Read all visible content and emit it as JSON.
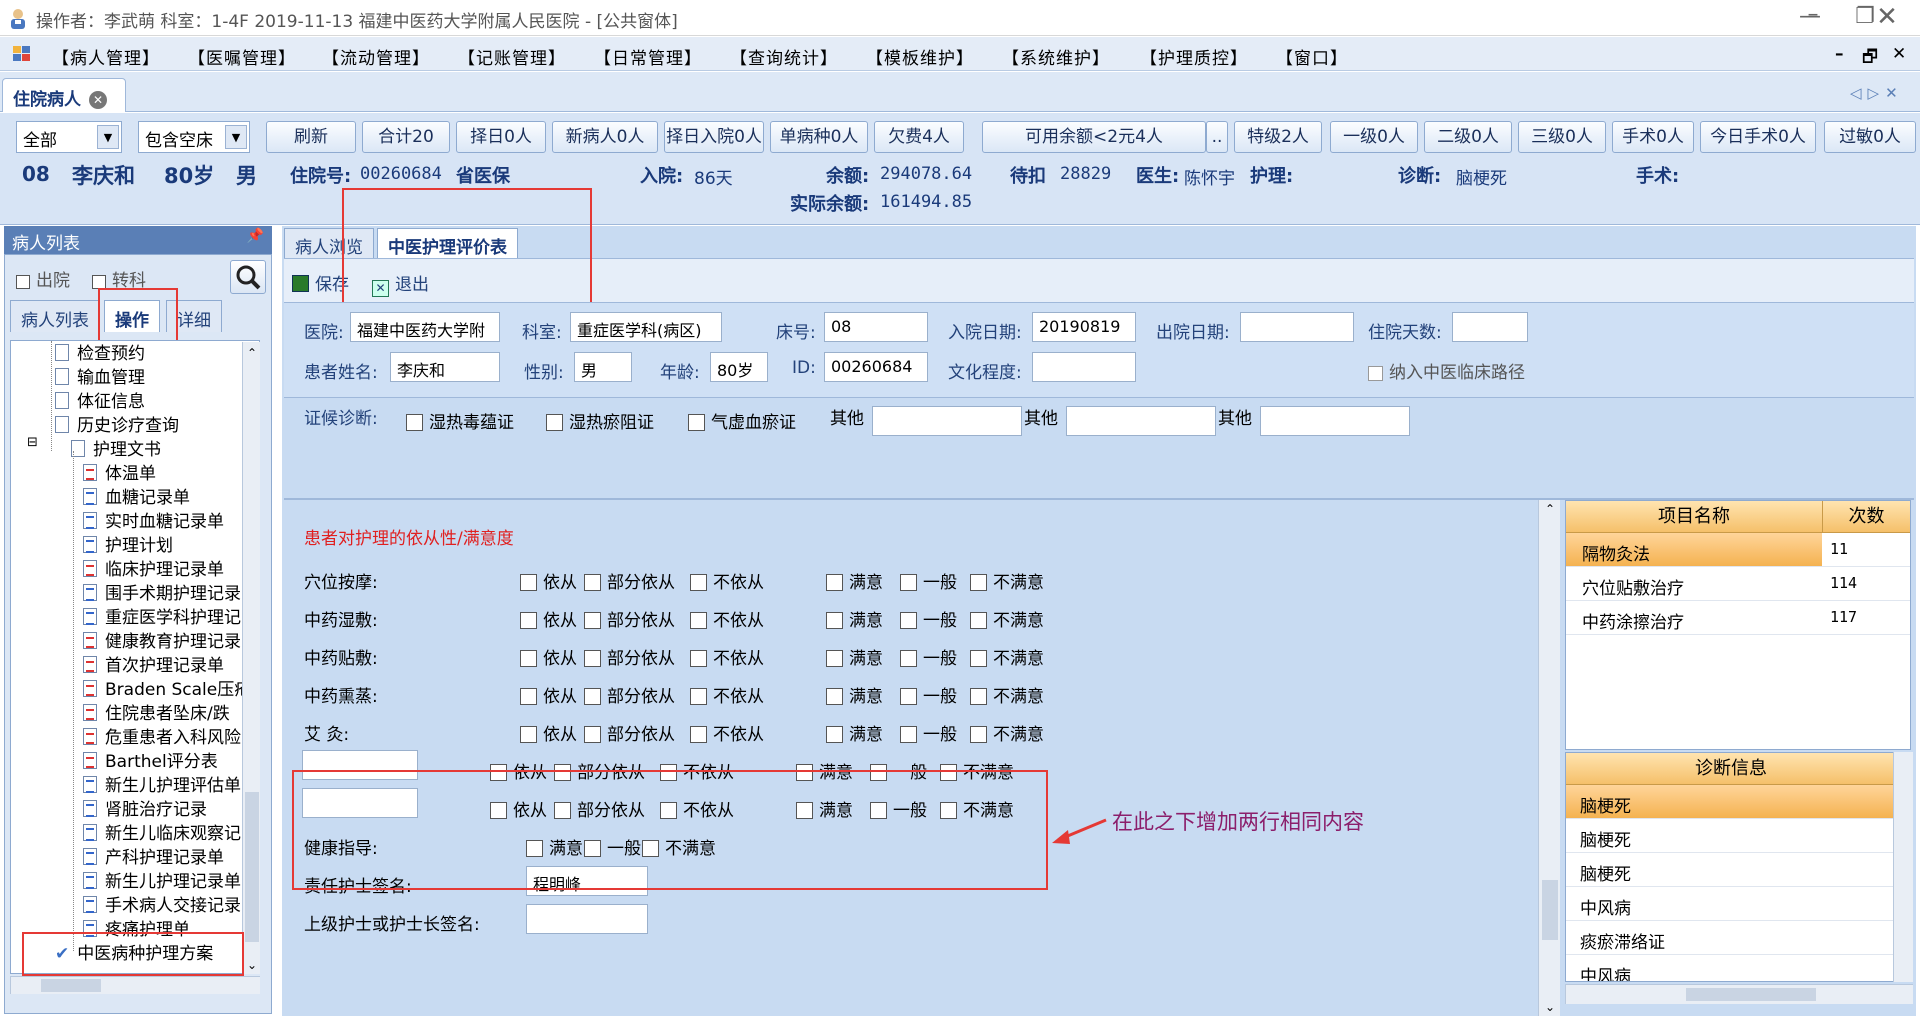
{
  "window": {
    "title": "操作者：李武萌  科室：1-4F  2019-11-13  福建中医药大学附属人民医院 - [公共窗体]"
  },
  "menu": [
    "【病人管理】",
    "【医嘱管理】",
    "【流动管理】",
    "【记账管理】",
    "【日常管理】",
    "【查询统计】",
    "【模板维护】",
    "【系统维护】",
    "【护理质控】",
    "【窗口】"
  ],
  "doc_tab": "住院病人",
  "toolbar": {
    "filter_all": "全部",
    "filter_bed": "包含空床",
    "buttons": [
      "刷新",
      "合计20",
      "择日0人",
      "新病人0人",
      "择日入院0人",
      "单病种0人",
      "欠费4人",
      "可用余额<2元4人",
      "..",
      "特级2人",
      "一级0人",
      "二级0人",
      "三级0人",
      "手术0人",
      "今日手术0人",
      "过敏0人"
    ]
  },
  "patient": {
    "bed": "08",
    "name": "李庆和",
    "age": "80岁",
    "sex": "男",
    "admission_label": "住院号:",
    "admission_no": "00260684",
    "insurance": "省医保",
    "in_label": "入院:",
    "in_days": "86天",
    "balance_label": "余额:",
    "balance": "294078.64",
    "pending_label": "待扣",
    "pending": "28829",
    "doctor_label": "医生:",
    "doctor": "陈怀宇",
    "nurse_label": "护理:",
    "nurse": "",
    "diagnosis_label": "诊断:",
    "diagnosis": "脑梗死",
    "surgery_label": "手术:",
    "surgery": "",
    "actual_label": "实际余额:",
    "actual_balance": "161494.85"
  },
  "left": {
    "header": "病人列表",
    "pin": "ㅁ",
    "chk_discharged": "出院",
    "chk_transfer": "转科",
    "tabs": [
      "病人列表",
      "操作",
      "详细"
    ],
    "tree": [
      {
        "label": "检查预约",
        "icon": "doc",
        "indent": 1
      },
      {
        "label": "输血管理",
        "icon": "doc",
        "indent": 1
      },
      {
        "label": "体征信息",
        "icon": "doc",
        "indent": 1
      },
      {
        "label": "历史诊疗查询",
        "icon": "doc",
        "indent": 1
      },
      {
        "label": "护理文书",
        "icon": "doc",
        "indent": 0
      },
      {
        "label": "体温单",
        "icon": "red",
        "indent": 2
      },
      {
        "label": "血糖记录单",
        "icon": "blue",
        "indent": 2
      },
      {
        "label": "实时血糖记录单",
        "icon": "blue",
        "indent": 2
      },
      {
        "label": "护理计划",
        "icon": "blue",
        "indent": 2
      },
      {
        "label": "临床护理记录单",
        "icon": "red",
        "indent": 2
      },
      {
        "label": "围手术期护理记录",
        "icon": "blue",
        "indent": 2
      },
      {
        "label": "重症医学科护理记",
        "icon": "blue",
        "indent": 2
      },
      {
        "label": "健康教育护理记录",
        "icon": "red",
        "indent": 2
      },
      {
        "label": "首次护理记录单",
        "icon": "red",
        "indent": 2
      },
      {
        "label": "Braden Scale压疮",
        "icon": "red",
        "indent": 2
      },
      {
        "label": "住院患者坠床/跌",
        "icon": "red",
        "indent": 2
      },
      {
        "label": "危重患者入科风险",
        "icon": "red",
        "indent": 2
      },
      {
        "label": "Barthel评分表",
        "icon": "red",
        "indent": 2
      },
      {
        "label": "新生儿护理评估单",
        "icon": "blue",
        "indent": 2
      },
      {
        "label": "肾脏治疗记录",
        "icon": "blue",
        "indent": 2
      },
      {
        "label": "新生儿临床观察记",
        "icon": "blue",
        "indent": 2
      },
      {
        "label": "产科护理记录单",
        "icon": "blue",
        "indent": 2
      },
      {
        "label": "新生儿护理记录单",
        "icon": "blue",
        "indent": 2
      },
      {
        "label": "手术病人交接记录",
        "icon": "blue",
        "indent": 2
      },
      {
        "label": "疼痛护理单",
        "icon": "blue",
        "indent": 2
      },
      {
        "label": "中医病种护理方案",
        "icon": "check",
        "indent": 1
      }
    ]
  },
  "right_tabs": [
    "病人浏览",
    "中医护理评价表"
  ],
  "actions": {
    "save": "保存",
    "exit": "退出"
  },
  "form": {
    "hospital_label": "医院:",
    "hospital": "福建中医药大学附",
    "dept_label": "科室:",
    "dept": "重症医学科(病区)",
    "bed_label": "床号:",
    "bed": "08",
    "admit_date_label": "入院日期:",
    "admit_date": "20190819",
    "discharge_label": "出院日期:",
    "discharge": "",
    "stay_label": "住院天数:",
    "stay": "",
    "name_label": "患者姓名:",
    "name": "李庆和",
    "sex_label": "性别:",
    "sex": "男",
    "age_label": "年龄:",
    "age": "80岁",
    "id_label": "ID:",
    "id": "00260684",
    "edu_label": "文化程度:",
    "edu": "",
    "pathway": "纳入中医临床路径"
  },
  "syndrome": {
    "label": "证候诊断:",
    "options": [
      "湿热毒蕴证",
      "湿热瘀阻证",
      "气虚血瘀证"
    ],
    "other": "其他"
  },
  "eval": {
    "title": "患者对护理的依从性/满意度",
    "rows": [
      "穴位按摩:",
      "中药湿敷:",
      "中药贴敷:",
      "中药熏蒸:",
      "艾    灸:"
    ],
    "compliance": [
      "依从",
      "部分依从",
      "不依从"
    ],
    "satisfaction": [
      "满意",
      "一般",
      "不满意"
    ],
    "annotation": "在此之下增加两行相同内容",
    "health_label": "健康指导:",
    "nurse_sign_label": "责任护士签名:",
    "nurse_sign": "程明峰",
    "head_sign_label": "上级护士或护士长签名:"
  },
  "grid": {
    "col1": "项目名称",
    "col2": "次数",
    "rows": [
      [
        "隔物灸法",
        "11"
      ],
      [
        "穴位贴敷治疗",
        "114"
      ],
      [
        "中药涂擦治疗",
        "117"
      ]
    ]
  },
  "diag": {
    "header": "诊断信息",
    "rows": [
      "脑梗死",
      "脑梗死",
      "脑梗死",
      "中风病",
      "痰瘀滞络证",
      "中风病"
    ]
  }
}
